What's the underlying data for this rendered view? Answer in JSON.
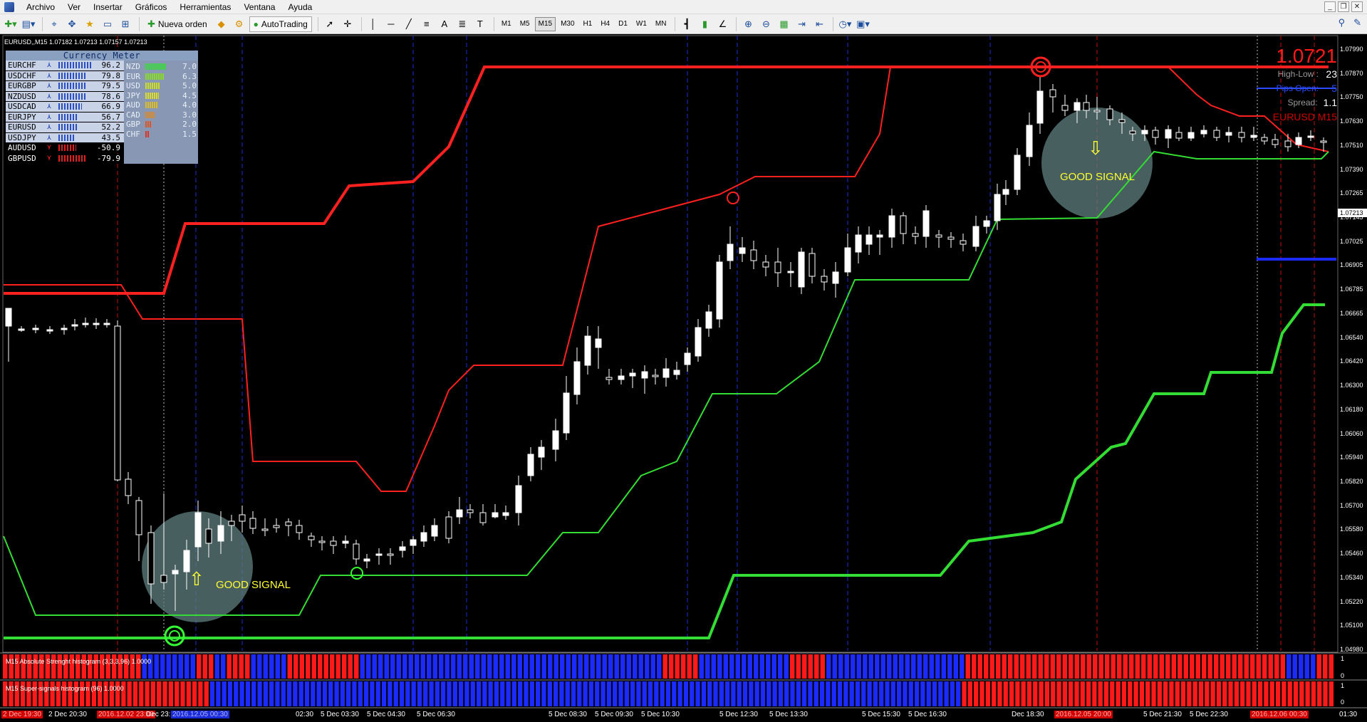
{
  "menu": {
    "items": [
      "Archivo",
      "Ver",
      "Insertar",
      "Gráficos",
      "Herramientas",
      "Ventana",
      "Ayuda"
    ]
  },
  "toolbar": {
    "new_order_label": "Nueva orden",
    "autotrading_label": "AutoTrading",
    "timeframes": [
      "M1",
      "M5",
      "M15",
      "M30",
      "H1",
      "H4",
      "D1",
      "W1",
      "MN"
    ],
    "active_timeframe": "M15"
  },
  "chart": {
    "header": "EURUSD,,M15  1.07182 1.07213 1.07157 1.07213",
    "price_axis_labels": [
      "1.07990",
      "1.07870",
      "1.07750",
      "1.07630",
      "1.07510",
      "1.07390",
      "1.07265",
      "1.07145",
      "1.07025",
      "1.06905",
      "1.06785",
      "1.06665",
      "1.06540",
      "1.06420",
      "1.06300",
      "1.06180",
      "1.06060",
      "1.05940",
      "1.05820",
      "1.05700",
      "1.05580",
      "1.05460",
      "1.05340",
      "1.05220",
      "1.05100",
      "1.04980"
    ],
    "current_price_label": "1.07213",
    "accent_colors": {
      "bull_line": "#33ff33",
      "bear_line": "#ff2020",
      "candle": "#ffffff",
      "signal_text": "#ffff33"
    }
  },
  "currency_meter": {
    "title": "Currency Meter",
    "pairs": [
      {
        "name": "EURCHF",
        "value": "96.2",
        "dir": "up"
      },
      {
        "name": "USDCHF",
        "value": "79.8",
        "dir": "up"
      },
      {
        "name": "EURGBP",
        "value": "79.5",
        "dir": "up"
      },
      {
        "name": "NZDUSD",
        "value": "78.6",
        "dir": "up"
      },
      {
        "name": "USDCAD",
        "value": "66.9",
        "dir": "up"
      },
      {
        "name": "EURJPY",
        "value": "56.7",
        "dir": "up"
      },
      {
        "name": "EURUSD",
        "value": "52.2",
        "dir": "up"
      },
      {
        "name": "USDJPY",
        "value": "43.5",
        "dir": "up"
      },
      {
        "name": "AUDUSD",
        "value": "-50.9",
        "dir": "down"
      },
      {
        "name": "GBPUSD",
        "value": "-79.9",
        "dir": "down"
      }
    ],
    "currencies": [
      {
        "name": "NZD",
        "value": "7.0",
        "color": "#33dd33"
      },
      {
        "name": "EUR",
        "value": "6.3",
        "color": "#88dd22"
      },
      {
        "name": "USD",
        "value": "5.0",
        "color": "#ccdd22"
      },
      {
        "name": "JPY",
        "value": "4.5",
        "color": "#dddd22"
      },
      {
        "name": "AUD",
        "value": "4.0",
        "color": "#ddbb22"
      },
      {
        "name": "CAD",
        "value": "3.0",
        "color": "#dd8822"
      },
      {
        "name": "GBP",
        "value": "2.0",
        "color": "#dd5522"
      },
      {
        "name": "CHF",
        "value": "1.5",
        "color": "#dd3322"
      }
    ]
  },
  "info_panel": {
    "price": "1.0721",
    "high_low_label": "High-Low :",
    "high_low_value": "23",
    "pips_open_label": "Pips Open:",
    "pips_open_value": "5",
    "spread_label": "Spread:",
    "spread_value": "1.1",
    "symbol_label": "EURUSD M15"
  },
  "signals": {
    "buy_label": "GOOD SIGNAL",
    "sell_label": "GOOD SIGNAL"
  },
  "subwindow1": {
    "title": "M15 Absolute Strenght histogram (3,3,3,96) 1.0000",
    "axis": [
      "1",
      "0"
    ]
  },
  "subwindow2": {
    "title": "M15 Super-signals histogram (96) 1.0000",
    "axis": [
      "1",
      "0"
    ]
  },
  "time_axis": {
    "labels": [
      {
        "text": "2 Dec 19:30",
        "style": "hl-red"
      },
      {
        "text": "2 Dec 20:30",
        "style": ""
      },
      {
        "text": "2016.12.02 23:00",
        "style": "hl-red"
      },
      {
        "text": "Dec 23:",
        "style": ""
      },
      {
        "text": "2016.12.05 00:30",
        "style": "hl-blue"
      },
      {
        "text": "02:30",
        "style": ""
      },
      {
        "text": "5 Dec 03:30",
        "style": ""
      },
      {
        "text": "5 Dec 04:30",
        "style": ""
      },
      {
        "text": "5 Dec 06:30",
        "style": ""
      },
      {
        "text": "5 Dec 08:30",
        "style": ""
      },
      {
        "text": "5 Dec 09:30",
        "style": ""
      },
      {
        "text": "5 Dec 10:30",
        "style": ""
      },
      {
        "text": "5 Dec 12:30",
        "style": ""
      },
      {
        "text": "5 Dec 13:30",
        "style": ""
      },
      {
        "text": "5 Dec 15:30",
        "style": ""
      },
      {
        "text": "5 Dec 16:30",
        "style": ""
      },
      {
        "text": "Dec 18:30",
        "style": ""
      },
      {
        "text": "2016.12.05 20:00",
        "style": "hl-red"
      },
      {
        "text": "5 Dec 21:30",
        "style": ""
      },
      {
        "text": "5 Dec 22:30",
        "style": ""
      },
      {
        "text": "2016.12.06 00:30",
        "style": "hl-red"
      },
      {
        "text": "01:30",
        "style": ""
      }
    ]
  }
}
